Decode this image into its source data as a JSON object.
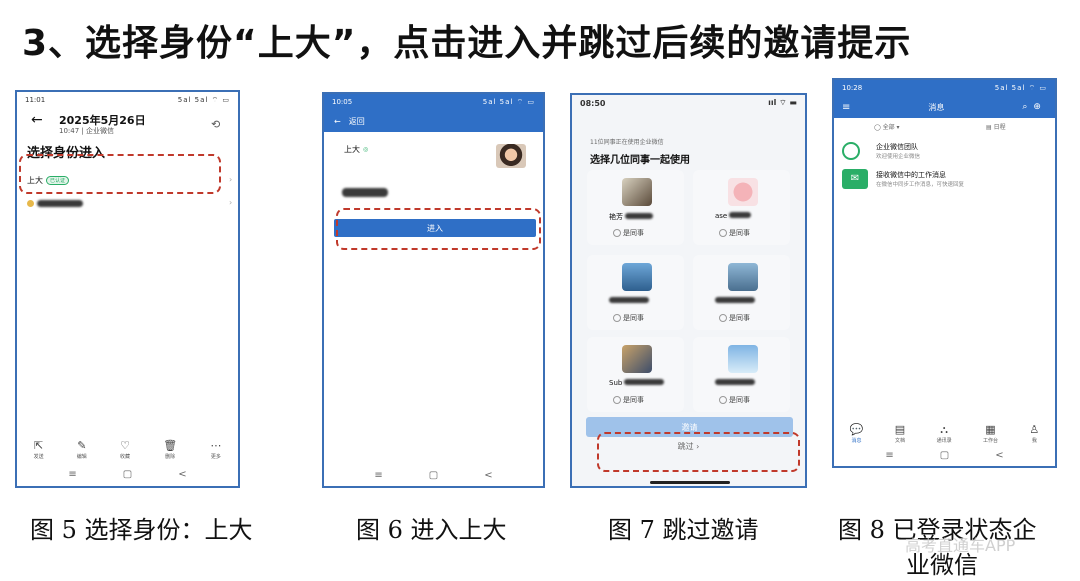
{
  "title": "3、选择身份“上大”，点击进入并跳过后续的邀请提示",
  "watermark": "高考直通车APP",
  "panel5": {
    "time": "11:01",
    "status_icons": "5al 5al ⌔ ▭",
    "date": "2025年5月26日",
    "subtitle": "10:47 | 企业微信",
    "heading": "选择身份进入",
    "identity_label": "上大",
    "identity_badge": "已认证",
    "toolbar": [
      {
        "icon": "share-icon",
        "glyph": "⇱",
        "label": "发送"
      },
      {
        "icon": "edit-icon",
        "glyph": "✎",
        "label": "编辑"
      },
      {
        "icon": "heart-icon",
        "glyph": "♡",
        "label": "收藏"
      },
      {
        "icon": "trash-icon",
        "glyph": "🗑",
        "label": "删除"
      },
      {
        "icon": "more-icon",
        "glyph": "⋯",
        "label": "更多"
      }
    ],
    "nav": [
      "≡",
      "▢",
      "<"
    ],
    "caption": "图 5  选择身份：上大"
  },
  "panel6": {
    "time": "10:05",
    "status_icons": "5al 5al ⌔ ▭",
    "back_label": "返回",
    "org_name": "上大",
    "enter_label": "进入",
    "nav": [
      "≡",
      "▢",
      "<"
    ],
    "caption": "图 6 进入上大"
  },
  "panel7": {
    "time": "08:50",
    "status_icons": "ııl ⌔ ▬",
    "notice": "11位同事正在使用企业微信",
    "heading": "选择几位同事一起使用",
    "colleagues": [
      {
        "name": "艳芳",
        "check": "是同事"
      },
      {
        "name": "ase",
        "check": "是同事"
      },
      {
        "name": "",
        "check": "是同事"
      },
      {
        "name": "",
        "check": "是同事"
      },
      {
        "name": "Sub",
        "check": "是同事"
      },
      {
        "name": "",
        "check": "是同事"
      }
    ],
    "invite_label": "邀请",
    "skip_label": "跳过 ›",
    "caption": "图 7 跳过邀请"
  },
  "panel8": {
    "time": "10:28",
    "status_icons": "5al 5al ⌔ ▭",
    "header_title": "消息",
    "filter_left": "◯ 全部 ▾",
    "filter_right": "▤ 日程",
    "messages": [
      {
        "title": "企业微信团队",
        "preview": "欢迎使用企业微信"
      },
      {
        "title": "接收微信中的工作消息",
        "preview": "在微信中同步工作消息，可快速回复"
      }
    ],
    "tabs": [
      {
        "icon": "chat-icon",
        "glyph": "💬",
        "label": "消息"
      },
      {
        "icon": "doc-icon",
        "glyph": "▤",
        "label": "文档"
      },
      {
        "icon": "org-icon",
        "glyph": "⛬",
        "label": "通讯录"
      },
      {
        "icon": "apps-icon",
        "glyph": "▦",
        "label": "工作台"
      },
      {
        "icon": "me-icon",
        "glyph": "♙",
        "label": "我"
      }
    ],
    "nav": [
      "≡",
      "▢",
      "<"
    ],
    "caption_line1": "图 8 已登录状态企",
    "caption_line2": "业微信"
  },
  "colors": {
    "accent": "#2f6fc6",
    "frame": "#3b6fb5",
    "highlight": "#c0392b",
    "wechat_green": "#2aae67"
  }
}
